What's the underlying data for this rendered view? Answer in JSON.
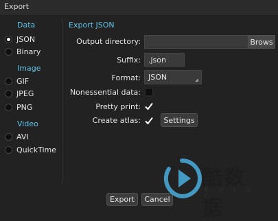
{
  "window": {
    "title": "Export"
  },
  "sidebar": {
    "groups": [
      {
        "label": "Data",
        "items": [
          {
            "label": "JSON",
            "selected": true
          },
          {
            "label": "Binary",
            "selected": false
          }
        ]
      },
      {
        "label": "Image",
        "items": [
          {
            "label": "GIF",
            "selected": false
          },
          {
            "label": "JPEG",
            "selected": false
          },
          {
            "label": "PNG",
            "selected": false
          }
        ]
      },
      {
        "label": "Video",
        "items": [
          {
            "label": "AVI",
            "selected": false
          },
          {
            "label": "QuickTime",
            "selected": false
          }
        ]
      }
    ]
  },
  "panel": {
    "title": "Export JSON",
    "output_directory": {
      "label": "Output directory:",
      "value": "",
      "browse_label": "Brows"
    },
    "suffix": {
      "label": "Suffix:",
      "value": ".json"
    },
    "format": {
      "label": "Format:",
      "value": "JSON"
    },
    "nonessential": {
      "label": "Nonessential data:",
      "checked": false
    },
    "pretty_print": {
      "label": "Pretty print:",
      "checked": true
    },
    "create_atlas": {
      "label": "Create atlas:",
      "checked": true,
      "settings_label": "Settings"
    }
  },
  "footer": {
    "export_label": "Export",
    "cancel_label": "Cancel"
  },
  "watermark": {
    "text": "酷数据",
    "sub": "K U I D C"
  },
  "colors": {
    "accent": "#5fc3e8",
    "background": "#222222",
    "watermark": "#4aaee0"
  },
  "icons": {
    "check": "check-icon",
    "play": "play-logo-icon"
  }
}
